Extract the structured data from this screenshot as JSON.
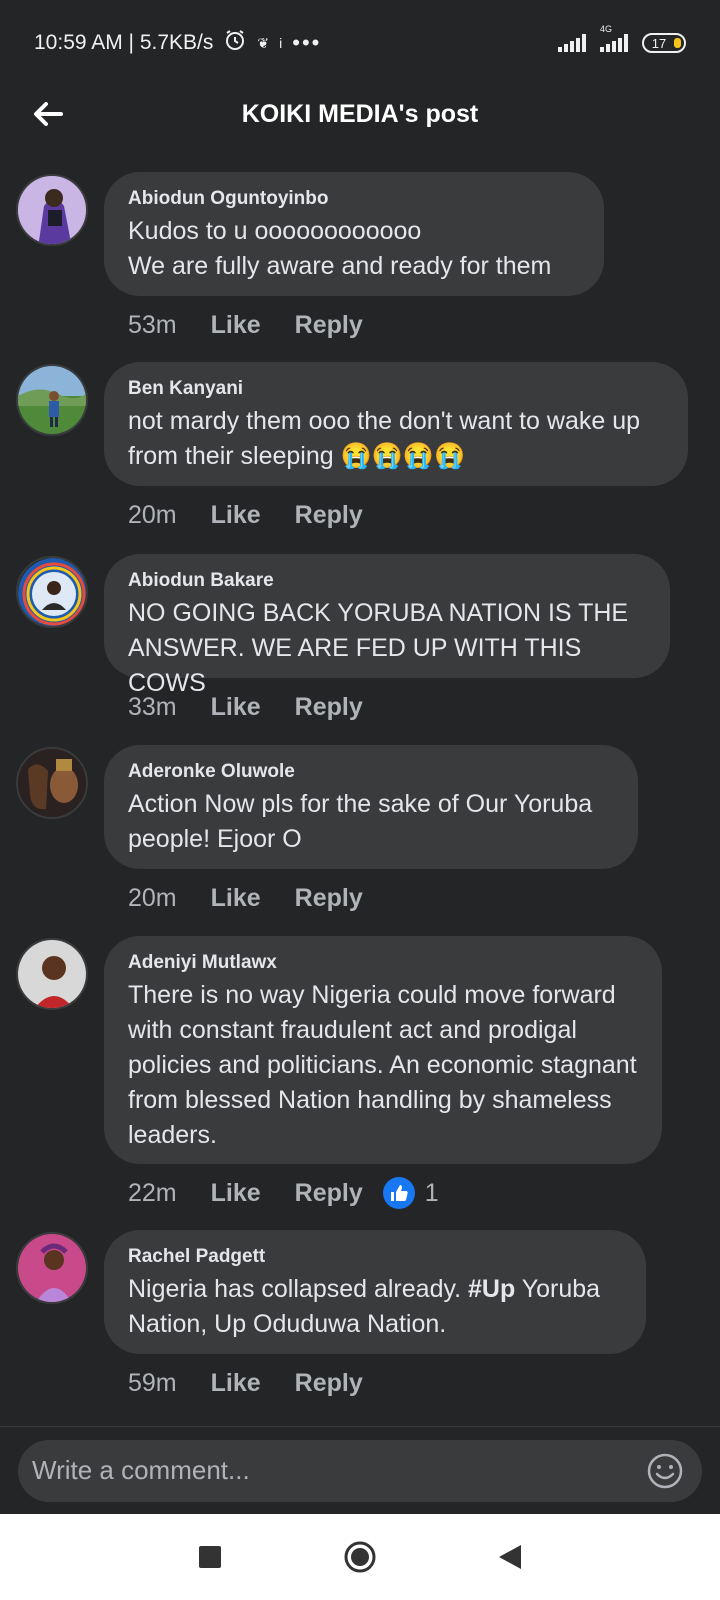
{
  "status": {
    "time_speed": "10:59 AM | 5.7KB/s",
    "network": "4G",
    "battery": "17"
  },
  "header": {
    "title": "KOIKI MEDIA's post"
  },
  "comments": [
    {
      "author": "Abiodun Oguntoyinbo",
      "text": "Kudos to u oooooooooooo\nWe are  fully aware and ready for  them",
      "time": "53m"
    },
    {
      "author": "Ben Kanyani",
      "text": "not mardy them ooo the don't want to wake up from their sleeping 😭😭😭😭",
      "time": "20m"
    },
    {
      "author": "Abiodun Bakare",
      "text": "NO GOING BACK YORUBA NATION IS THE ANSWER. WE ARE FED UP WITH THIS COWS",
      "time": "33m"
    },
    {
      "author": "Aderonke Oluwole",
      "text": "Action Now pls for the sake of Our Yoruba people! Ejoor O",
      "time": "20m"
    },
    {
      "author": "Adeniyi Mutlawx",
      "text": "There is no way Nigeria could move forward with constant fraudulent act and prodigal policies and politicians. An economic stagnant from blessed Nation handling by shameless leaders.",
      "time": "22m",
      "reactions": "1"
    },
    {
      "author": "Rachel Padgett",
      "text_pre": "Nigeria has collapsed already. ",
      "text_bold": "#Up",
      "text_post": " Yoruba Nation, Up Oduduwa Nation.",
      "time": "59m"
    }
  ],
  "actions": {
    "like": "Like",
    "reply": "Reply"
  },
  "composer": {
    "placeholder": "Write a comment..."
  },
  "colors": {
    "background": "#242526",
    "bubble": "#3a3b3c",
    "like_blue": "#1877f2"
  }
}
